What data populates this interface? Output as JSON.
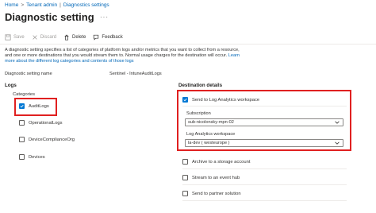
{
  "breadcrumb": {
    "items": [
      "Home",
      "Tenant admin",
      "Diagnostics settings"
    ]
  },
  "header": {
    "title": "Diagnostic setting",
    "actions_icon": "more-icon"
  },
  "toolbar": {
    "save_label": "Save",
    "discard_label": "Discard",
    "delete_label": "Delete",
    "feedback_label": "Feedback"
  },
  "description": {
    "text": "A diagnostic setting specifies a list of categories of platform logs and/or metrics that you want to collect from a resource, and one or more destinations that you would stream them to. Normal usage charges for the destination will occur.",
    "link1": "Learn",
    "link2": "more about the different log categories and contents of those logs"
  },
  "name_field": {
    "label": "Diagnostic setting name",
    "value": "Sentinel - IntuneAuditLogs"
  },
  "logs": {
    "heading": "Logs",
    "categories_label": "Categories",
    "items": [
      {
        "label": "AuditLogs",
        "checked": true
      },
      {
        "label": "OperationalLogs",
        "checked": false
      },
      {
        "label": "DeviceComplianceOrg",
        "checked": false
      },
      {
        "label": "Devices",
        "checked": false
      }
    ]
  },
  "destination": {
    "heading": "Destination details",
    "log_analytics": {
      "label": "Send to Log Analytics workspace",
      "checked": true,
      "subscription_label": "Subscription",
      "subscription_value": "sub-nicolonsky-mpn-02",
      "workspace_label": "Log Analytics workspace",
      "workspace_value": "la-dev ( westeurope )"
    },
    "others": [
      {
        "label": "Archive to a storage account",
        "checked": false
      },
      {
        "label": "Stream to an event hub",
        "checked": false
      },
      {
        "label": "Send to partner solution",
        "checked": false
      }
    ]
  },
  "colors": {
    "accent": "#0078d4",
    "link": "#0067b8",
    "highlight": "#e02020"
  }
}
